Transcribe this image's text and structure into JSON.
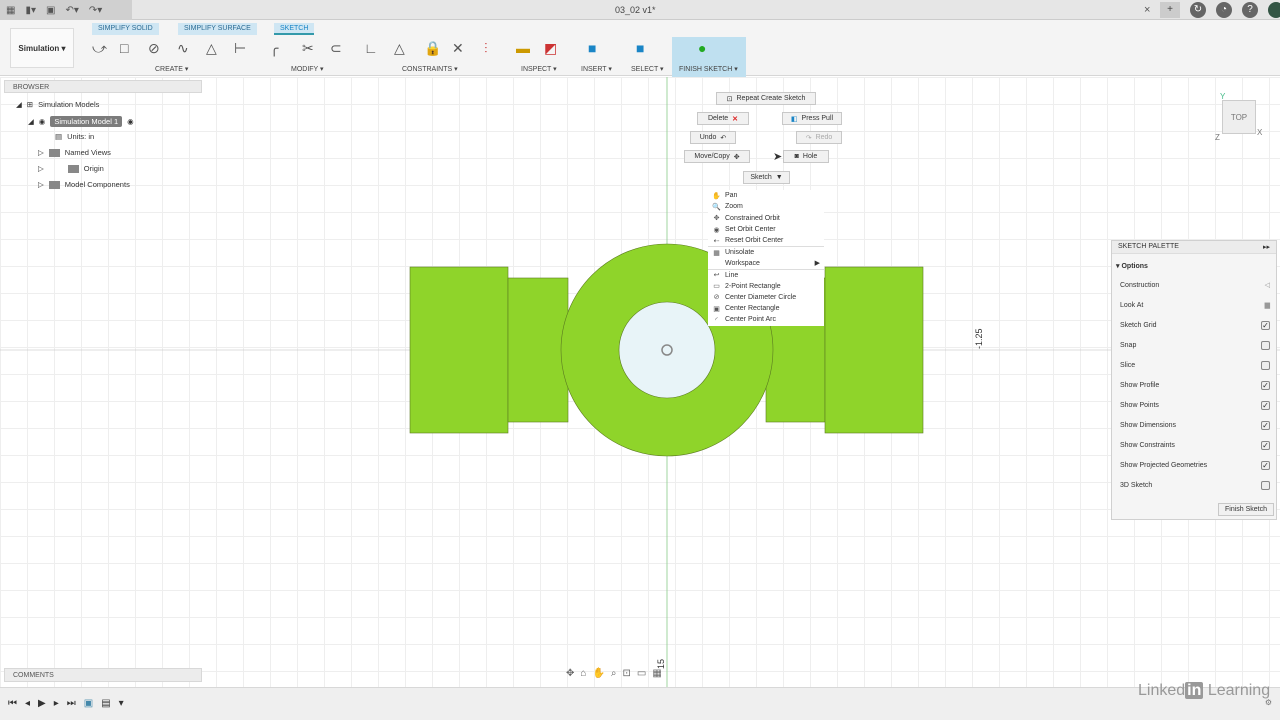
{
  "title_bar": {
    "document": "03_02 v1*",
    "close": "×",
    "plus": "+"
  },
  "ribbon": {
    "workspace": "Simulation ▾",
    "tabs": [
      "SIMPLIFY SOLID",
      "SIMPLIFY SURFACE",
      "SKETCH"
    ],
    "groups": {
      "create": "CREATE ▾",
      "modify": "MODIFY ▾",
      "constraints": "CONSTRAINTS ▾",
      "inspect": "INSPECT ▾",
      "insert": "INSERT ▾",
      "select": "SELECT ▾",
      "finish": "FINISH SKETCH ▾"
    }
  },
  "browser": {
    "header": "BROWSER",
    "items": [
      "Simulation Models",
      "Simulation Model 1",
      "Units: in",
      "Named Views",
      "Origin",
      "Model Components"
    ]
  },
  "comments": {
    "header": "COMMENTS"
  },
  "marking_menu": {
    "repeat": "Repeat Create Sketch",
    "delete": "Delete",
    "press_pull": "Press Pull",
    "undo": "Undo",
    "redo": "Redo",
    "move_copy": "Move/Copy",
    "hole": "Hole",
    "sketch": "Sketch"
  },
  "context_menu": [
    {
      "label": "Pan",
      "icon": "✋"
    },
    {
      "label": "Zoom",
      "icon": "🔍"
    },
    {
      "label": "Constrained Orbit",
      "icon": "✥"
    },
    {
      "label": "Set Orbit Center",
      "icon": "◉"
    },
    {
      "label": "Reset Orbit Center",
      "icon": "⇠"
    },
    {
      "label": "Unisolate",
      "icon": "▦"
    },
    {
      "label": "Workspace",
      "icon": ""
    },
    {
      "label": "Line",
      "icon": "↩"
    },
    {
      "label": "2-Point Rectangle",
      "icon": "▭"
    },
    {
      "label": "Center Diameter Circle",
      "icon": "⊘"
    },
    {
      "label": "Center Rectangle",
      "icon": "▣"
    },
    {
      "label": "Center Point Arc",
      "icon": "◜"
    }
  ],
  "sketch_palette": {
    "header": "SKETCH PALETTE",
    "section": "Options",
    "finish": "Finish Sketch",
    "rows": [
      {
        "label": "Construction",
        "type": "icon"
      },
      {
        "label": "Look At",
        "type": "icon"
      },
      {
        "label": "Sketch Grid",
        "checked": true
      },
      {
        "label": "Snap",
        "checked": false
      },
      {
        "label": "Slice",
        "checked": false
      },
      {
        "label": "Show Profile",
        "checked": true
      },
      {
        "label": "Show Points",
        "checked": true
      },
      {
        "label": "Show Dimensions",
        "checked": true
      },
      {
        "label": "Show Constraints",
        "checked": true
      },
      {
        "label": "Show Projected Geometries",
        "checked": true
      },
      {
        "label": "3D Sketch",
        "checked": false
      }
    ]
  },
  "viewcube": {
    "face": "TOP",
    "x": "X",
    "y": "Y",
    "z": "Z"
  },
  "dimensions": {
    "vertical": "-1.25",
    "horizontal": "15"
  },
  "branding": {
    "linkedin": "Linked",
    "in": "in",
    "learning": "Learning"
  },
  "colors": {
    "part": "#8fd42a",
    "hole": "#e8f4f8",
    "accent": "#1a85c6"
  }
}
